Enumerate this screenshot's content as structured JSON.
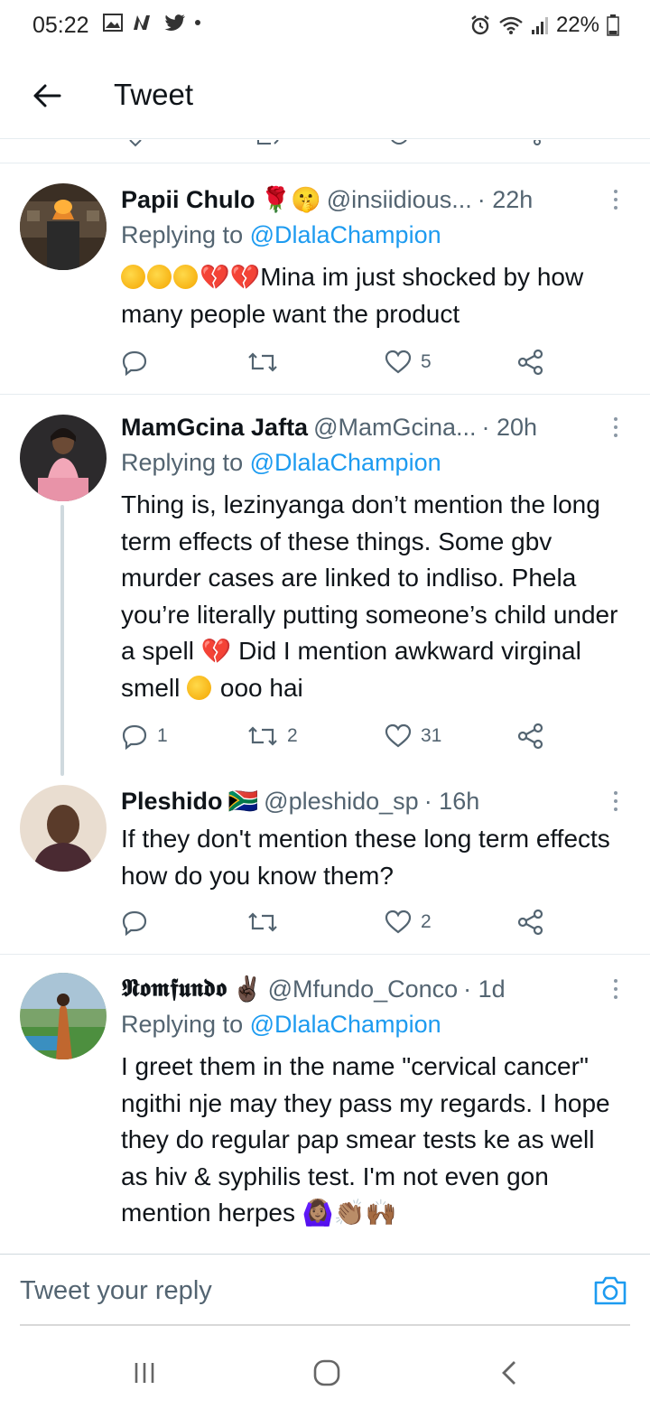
{
  "status_bar": {
    "time": "05:22",
    "battery": "22%",
    "left_icons": [
      "gallery-icon",
      "n-app-icon",
      "twitter-icon",
      "dot-icon"
    ],
    "right_icons": [
      "alarm-icon",
      "wifi-icon",
      "signal-icon",
      "battery-icon"
    ]
  },
  "header": {
    "title": "Tweet"
  },
  "tweets": [
    {
      "name": "Papii Chulo",
      "name_emoji": "🌹🤫",
      "handle": "@insiidious...",
      "time": "· 22h",
      "replying_prefix": "Replying to ",
      "replying_to": "@DlalaChampion",
      "text_after_emoji": "Mina im just shocked by how many people want the product",
      "counts": {
        "reply": "",
        "retweet": "",
        "like": "5"
      }
    },
    {
      "name": "MamGcina Jafta",
      "handle": "@MamGcina...",
      "time": "· 20h",
      "replying_prefix": "Replying to ",
      "replying_to": "@DlalaChampion",
      "text_part1": "Thing is, lezinyanga don’t mention the long term effects of these things. Some gbv murder cases are linked to indliso. Phela you’re literally putting someone’s child under a spell",
      "text_part2": " Did I mention awkward virginal smell",
      "text_part3": " ooo hai",
      "counts": {
        "reply": "1",
        "retweet": "2",
        "like": "31"
      }
    },
    {
      "name": "Pleshido",
      "name_emoji": "🇿🇦",
      "handle": "@pleshido_sp",
      "time": "· 16h",
      "text": "If they don't mention these long term effects how do you know them?",
      "counts": {
        "reply": "",
        "retweet": "",
        "like": "2"
      }
    },
    {
      "name": "𝕹𝖔𝖒𝖋𝖚𝖓𝖉𝖔",
      "name_emoji": "✌🏿",
      "handle": "@Mfundo_Conco",
      "time": "· 1d",
      "replying_prefix": "Replying to ",
      "replying_to": "@DlalaChampion",
      "text": "I greet them in the name \"cervical cancer\" ngithi nje may they pass my regards. I hope they do regular pap smear tests ke as well as hiv & syphilis test. I'm not even gon mention herpes",
      "text_emoji": "🙆🏽‍♀️👏🏽🙌🏾"
    }
  ],
  "composer": {
    "placeholder": "Tweet your reply"
  },
  "colors": {
    "accent": "#1d9bf0",
    "text": "#0f1419",
    "secondary": "#536471",
    "divider": "#e6ecf0"
  }
}
